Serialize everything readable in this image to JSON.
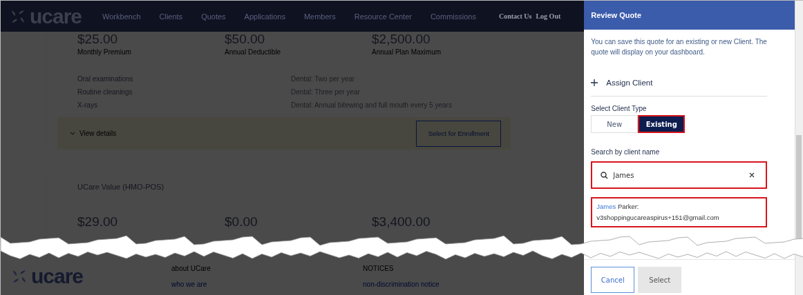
{
  "nav": {
    "logo": "ucare",
    "links": [
      "Workbench",
      "Clients",
      "Quotes",
      "Applications",
      "Members",
      "Resource Center",
      "Commissions"
    ],
    "utility_links": [
      "Contact Us",
      "Log Out"
    ]
  },
  "plan_1": {
    "amounts": [
      {
        "value": "$25.00",
        "label": "Monthly Premium"
      },
      {
        "value": "$50.00",
        "label": "Annual Deductible"
      },
      {
        "value": "$2,500.00",
        "label": "Annual Plan Maximum"
      }
    ],
    "benefits": [
      {
        "name": "Oral examinations",
        "detail": "Dental: Two per year"
      },
      {
        "name": "Routine cleanings",
        "detail": "Dental: Three per year"
      },
      {
        "name": "X-rays",
        "detail": "Dental: Annual bitewing and full mouth every 5 years"
      }
    ],
    "view_details": "View details",
    "enroll_button": "Select for Enrollment"
  },
  "plan_2": {
    "title": "UCare Value (HMO-POS)",
    "amounts": [
      "$29.00",
      "$0.00",
      "$3,400.00"
    ]
  },
  "footer": {
    "logo": "ucare",
    "columns": [
      {
        "heading": "about UCare",
        "link": "who we are"
      },
      {
        "heading": "NOTICES",
        "link": "non-discrimination notice"
      }
    ]
  },
  "panel": {
    "title": "Review Quote",
    "intro": "You can save this quote for an existing or new Client. The quote will display on your dashboard.",
    "assign": "Assign Client",
    "client_type_label": "Select Client Type",
    "client_types": [
      {
        "label": "New",
        "selected": false,
        "highlighted": false
      },
      {
        "label": "Existing",
        "selected": true,
        "highlighted": true
      }
    ],
    "search_label": "Search by client name",
    "search": {
      "value": "James",
      "highlighted": true
    },
    "results": {
      "highlighted": true,
      "items": [
        {
          "match": "James",
          "rest": " Parker:",
          "email": "v3shoppingucareaspirus+151@gmail.com"
        }
      ]
    },
    "cancel_button": "Cancel",
    "select_button": {
      "label": "Select",
      "disabled": true
    }
  }
}
